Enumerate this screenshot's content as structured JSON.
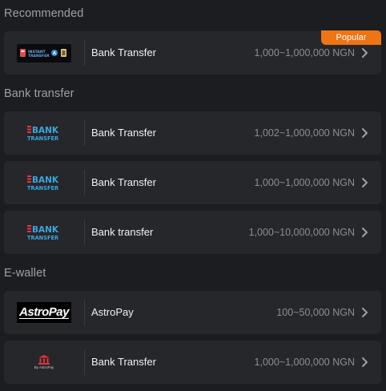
{
  "sections": {
    "recommended": "Recommended",
    "bank_transfer": "Bank transfer",
    "ewallet": "E-wallet"
  },
  "items": [
    {
      "name": "Bank Transfer",
      "range": "1,000~1,000,000 NGN",
      "badge": "Popular",
      "logo": "instant-transfer-logo"
    },
    {
      "name": "Bank Transfer",
      "range": "1,002~1,000,000 NGN",
      "logo": "bank-transfer-logo"
    },
    {
      "name": "Bank Transfer",
      "range": "1,000~1,000,000 NGN",
      "logo": "bank-transfer-logo"
    },
    {
      "name": "Bank transfer",
      "range": "1,000~10,000,000 NGN",
      "logo": "bank-transfer-logo"
    },
    {
      "name": "AstroPay",
      "range": "100~50,000 NGN",
      "logo": "astropay-logo"
    },
    {
      "name": "Bank Transfer",
      "range": "1,000~1,000,000 NGN",
      "logo": "bank-by-astropay-logo"
    }
  ],
  "logos": {
    "bank_word": "BANK",
    "transfer_word": "TRANSFER",
    "astropay": "AstroPay",
    "by_astropay": "By AstroPay"
  },
  "colors": {
    "background": "#1c1d20",
    "card": "#26272b",
    "badge": "#ee7414",
    "bank_red": "#e8333a",
    "bank_blue": "#3aa6dc"
  }
}
